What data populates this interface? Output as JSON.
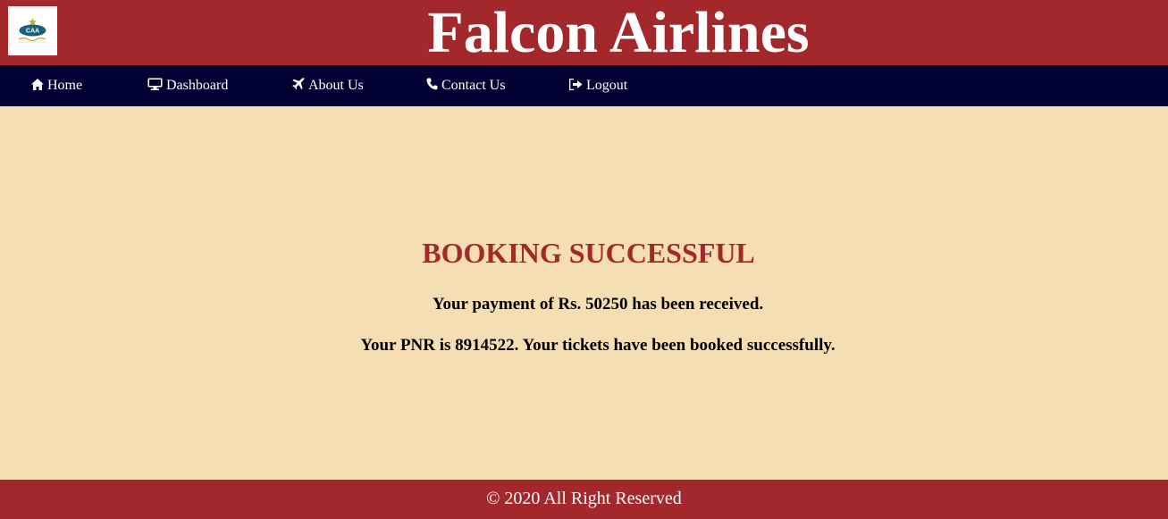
{
  "header": {
    "title": "Falcon Airlines",
    "logo_icon": "caa-logo",
    "logo_text": "CAA"
  },
  "nav": {
    "items": [
      {
        "label": "Home",
        "icon": "home-icon"
      },
      {
        "label": "Dashboard",
        "icon": "monitor-icon"
      },
      {
        "label": "About Us",
        "icon": "plane-icon"
      },
      {
        "label": "Contact Us",
        "icon": "phone-icon"
      },
      {
        "label": "Logout",
        "icon": "logout-icon"
      }
    ]
  },
  "main": {
    "heading": "BOOKING SUCCESSFUL",
    "payment_message": "Your payment of Rs. 50250 has been received.",
    "pnr_message": "Your PNR is 8914522. Your tickets have been booked successfully."
  },
  "footer": {
    "text": "© 2020 All Right Reserved"
  },
  "colors": {
    "brand_red": "#a3282b",
    "nav_navy": "#000033",
    "background": "#f5deb3"
  }
}
